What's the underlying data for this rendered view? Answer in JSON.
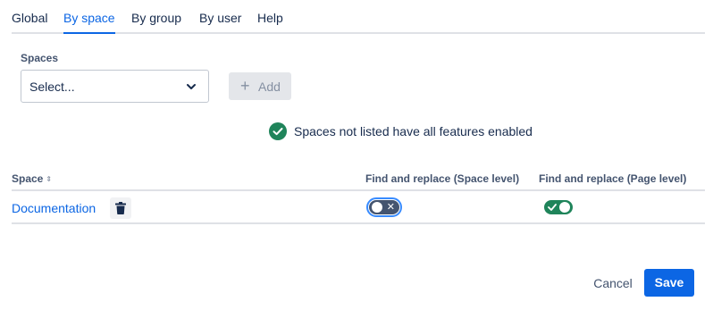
{
  "tabs": [
    {
      "label": "Global",
      "active": false
    },
    {
      "label": "By space",
      "active": true
    },
    {
      "label": "By group",
      "active": false
    },
    {
      "label": "By user",
      "active": false
    },
    {
      "label": "Help",
      "active": false
    }
  ],
  "spaces_picker": {
    "label": "Spaces",
    "placeholder": "Select...",
    "add_button": {
      "icon": "plus-icon",
      "label": "Add",
      "enabled": false
    }
  },
  "info_message": {
    "icon": "check-circle-icon",
    "text": "Spaces not listed have all features enabled",
    "color": "#1f845a"
  },
  "table": {
    "columns": [
      {
        "label": "Space",
        "sortable": true
      },
      {
        "label": "Find and replace (Space level)"
      },
      {
        "label": "Find and replace (Page level)"
      }
    ],
    "rows": [
      {
        "space": "Documentation",
        "space_level_enabled": false,
        "page_level_enabled": true
      }
    ]
  },
  "footer": {
    "cancel_label": "Cancel",
    "save_label": "Save"
  },
  "colors": {
    "accent": "#0c66e4",
    "toggle_on": "#1f845a",
    "toggle_off": "#44546f"
  }
}
